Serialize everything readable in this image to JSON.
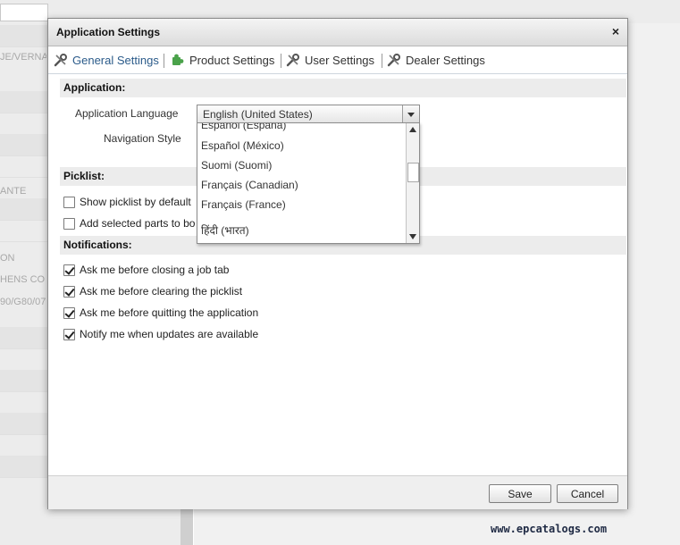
{
  "dialog": {
    "title": "Application Settings",
    "close_symbol": "×",
    "tabs": [
      {
        "label": "General Settings",
        "icon": "wrench-icon",
        "active": true
      },
      {
        "label": "Product Settings",
        "icon": "puzzle-icon",
        "active": false
      },
      {
        "label": "User Settings",
        "icon": "wrench-icon",
        "active": false
      },
      {
        "label": "Dealer Settings",
        "icon": "wrench-icon",
        "active": false
      }
    ],
    "sections": {
      "application": "Application:",
      "picklist": "Picklist:",
      "notifications": "Notifications:"
    },
    "application": {
      "language_label": "Application Language",
      "language_value": "English (United States)",
      "navigation_label": "Navigation Style"
    },
    "language_options": [
      "Español (España)",
      "Español (México)",
      "Suomi (Suomi)",
      "Français (Canadian)",
      "Français (France)",
      "हिंदी (भारत)"
    ],
    "picklist_options": [
      {
        "label": "Show picklist by default",
        "checked": false
      },
      {
        "label": "Add selected parts to bo",
        "checked": false
      }
    ],
    "notification_options": [
      {
        "label": "Ask me before closing a job tab",
        "checked": true
      },
      {
        "label": "Ask me before clearing the picklist",
        "checked": true
      },
      {
        "label": "Ask me before quitting the application",
        "checked": true
      },
      {
        "label": "Notify me when updates are available",
        "checked": true
      }
    ],
    "buttons": {
      "save": "Save",
      "cancel": "Cancel"
    }
  },
  "background": {
    "left_items": [
      "JE/VERNA",
      "ANTE",
      "ON",
      "HENS CO",
      "90/G80/07"
    ]
  },
  "watermark": "www.epcatalogs.com"
}
